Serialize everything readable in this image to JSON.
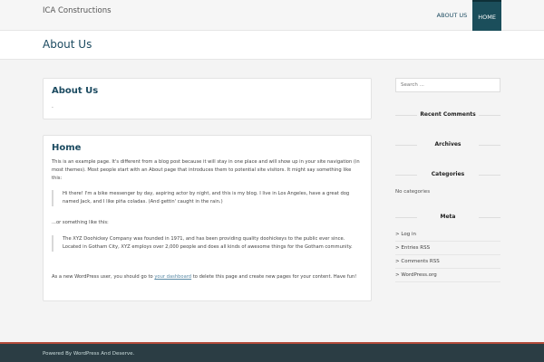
{
  "header": {
    "site_title": "ICA Constructions",
    "nav": [
      {
        "label": "ABOUT US",
        "active": false
      },
      {
        "label": "HOME",
        "active": true
      }
    ]
  },
  "page": {
    "title": "About Us"
  },
  "main": {
    "card1": {
      "title": "About Us",
      "body": "."
    },
    "card2": {
      "title": "Home",
      "p1": "This is an example page. It's different from a blog post because it will stay in one place and will show up in your site navigation (in most themes). Most people start with an About page that introduces them to potential site visitors. It might say something like this:",
      "q1": "Hi there! I'm a bike messenger by day, aspiring actor by night, and this is my blog. I live in Los Angeles, have a great dog named Jack, and I like piña coladas. (And gettin' caught in the rain.)",
      "p2": "...or something like this:",
      "q2": "The XYZ Doohickey Company was founded in 1971, and has been providing quality doohickeys to the public ever since. Located in Gotham City, XYZ employs over 2,000 people and does all kinds of awesome things for the Gotham community.",
      "p3_before": "As a new WordPress user, you should go to ",
      "p3_link": "your dashboard",
      "p3_after": " to delete this page and create new pages for your content. Have fun!"
    }
  },
  "sidebar": {
    "search_placeholder": "Search ...",
    "recent_comments_title": "Recent Comments",
    "archives_title": "Archives",
    "categories_title": "Categories",
    "categories_empty": "No categories",
    "meta_title": "Meta",
    "meta_items": [
      "Log in",
      "Entries RSS",
      "Comments RSS",
      "WordPress.org"
    ]
  },
  "footer": {
    "text": "Powered By WordPress And Deserve."
  },
  "colors": {
    "accent": "#1b4e5b",
    "footer_bg": "#2b3d44",
    "footer_border": "#b24a3a"
  }
}
